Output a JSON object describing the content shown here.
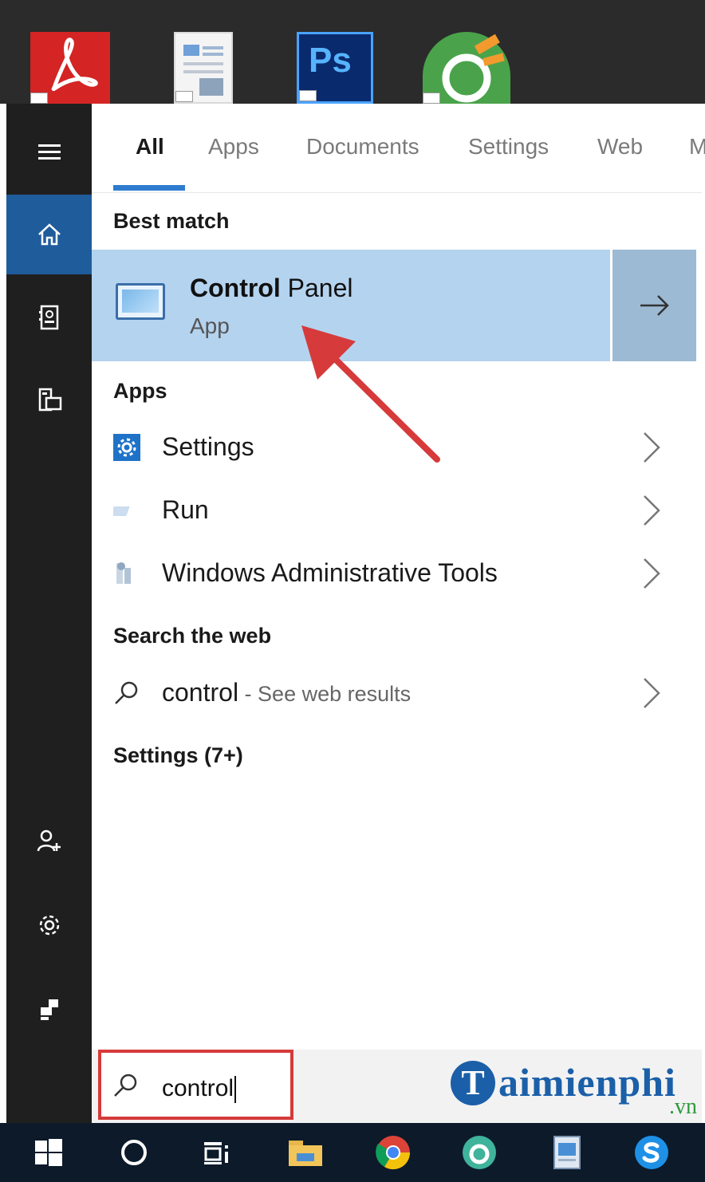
{
  "desktop": {
    "icons": [
      "adobe-acrobat-icon",
      "document-icon",
      "photoshop-icon",
      "coccoc-browser-icon"
    ],
    "ps_label": "Ps"
  },
  "rail": {
    "items": [
      "hamburger-menu-icon",
      "home-icon",
      "documents-icon",
      "devices-icon",
      "add-user-icon",
      "gear-icon",
      "user-icon"
    ]
  },
  "tabs": {
    "items": [
      {
        "label": "All",
        "active": true
      },
      {
        "label": "Apps",
        "active": false
      },
      {
        "label": "Documents",
        "active": false
      },
      {
        "label": "Settings",
        "active": false
      },
      {
        "label": "Web",
        "active": false
      },
      {
        "label": "M",
        "active": false
      }
    ]
  },
  "best_match": {
    "heading": "Best match",
    "title_bold": "Control",
    "title_rest": " Panel",
    "subtitle": "App"
  },
  "apps": {
    "heading": "Apps",
    "items": [
      {
        "label": "Settings",
        "icon": "settings-gear-icon"
      },
      {
        "label": "Run",
        "icon": "run-icon"
      },
      {
        "label": "Windows Administrative Tools",
        "icon": "admin-tools-icon"
      }
    ]
  },
  "web": {
    "heading": "Search the web",
    "query": "control",
    "suffix": " - See web results"
  },
  "settings_group": {
    "heading": "Settings (7+)"
  },
  "search": {
    "value": "control"
  },
  "watermark": {
    "logo_letter": "T",
    "text": "aimienphi",
    "tld": ".vn"
  },
  "colors": {
    "accent": "#2e7ccf",
    "selected": "#b4d3ef",
    "rail_bg": "#1f1f1f",
    "taskbar_bg": "#0c1a2a",
    "annotation": "#d63a3a"
  },
  "taskbar": {
    "items": [
      "windows-start-icon",
      "cortana-icon",
      "task-view-icon",
      "file-explorer-icon",
      "chrome-icon",
      "coccoc-icon",
      "photo-viewer-icon",
      "skype-icon"
    ]
  }
}
